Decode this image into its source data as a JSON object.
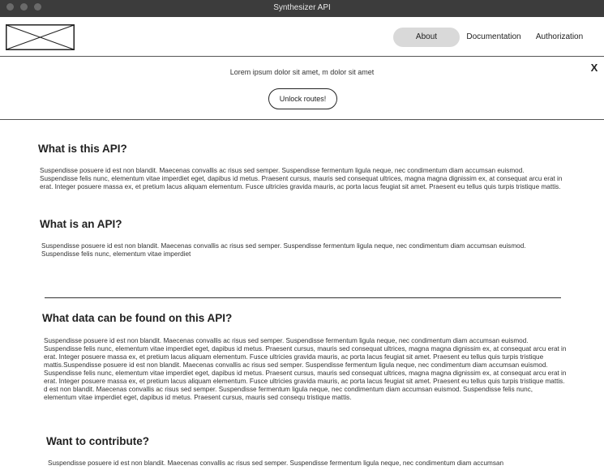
{
  "window": {
    "title": "Synthesizer API"
  },
  "nav": {
    "items": [
      {
        "label": "About",
        "active": true
      },
      {
        "label": "Documentation"
      },
      {
        "label": "Authorization"
      }
    ]
  },
  "banner": {
    "message": "Lorem ipsum dolor sit amet,  m dolor sit amet",
    "button_label": "Unlock routes!",
    "close_label": "X"
  },
  "sections": [
    {
      "heading": "What is this API?",
      "body": "Suspendisse posuere id est non blandit. Maecenas convallis ac risus sed semper. Suspendisse fermentum ligula neque, nec condimentum diam accumsan euismod. Suspendisse felis nunc, elementum vitae imperdiet eget, dapibus id metus. Praesent cursus, mauris sed consequat ultrices, magna magna dignissim ex, at consequat arcu erat in erat. Integer posuere massa ex, et pretium lacus aliquam elementum. Fusce ultricies gravida mauris, ac porta lacus feugiat sit amet. Praesent eu tellus quis turpis tristique mattis."
    },
    {
      "heading": "What is an API?",
      "body": "Suspendisse posuere id est non blandit. Maecenas convallis ac risus sed semper. Suspendisse fermentum ligula neque, nec condimentum diam accumsan euismod. Suspendisse felis nunc, elementum vitae imperdiet"
    },
    {
      "heading": "What data can be found on this API?",
      "body": "Suspendisse posuere id est non blandit. Maecenas convallis ac risus sed semper. Suspendisse fermentum ligula neque, nec condimentum diam accumsan euismod. Suspendisse felis nunc, elementum vitae imperdiet eget, dapibus id metus. Praesent cursus, mauris sed consequat ultrices, magna magna dignissim ex, at consequat arcu erat in erat. Integer posuere massa ex, et pretium lacus aliquam elementum. Fusce ultricies gravida mauris, ac porta lacus feugiat sit amet. Praesent eu tellus quis turpis tristique mattis.Suspendisse posuere id est non blandit. Maecenas convallis ac risus sed semper. Suspendisse fermentum ligula neque, nec condimentum diam accumsan euismod. Suspendisse felis nunc, elementum vitae imperdiet eget, dapibus id metus. Praesent cursus, mauris sed consequat ultrices, magna magna dignissim ex, at consequat arcu erat in erat. Integer posuere massa ex, et pretium lacus aliquam elementum. Fusce ultricies gravida mauris, ac porta lacus feugiat sit amet. Praesent eu tellus quis turpis tristique mattis. d est non blandit. Maecenas convallis ac risus sed semper. Suspendisse fermentum ligula neque, nec condimentum diam accumsan euismod. Suspendisse felis nunc, elementum vitae imperdiet eget, dapibus id metus. Praesent cursus, mauris sed consequ tristique mattis."
    },
    {
      "heading": "Want to contribute?",
      "body": "Suspendisse posuere id est non blandit. Maecenas convallis ac risus sed semper. Suspendisse fermentum ligula neque, nec condimentum diam accumsan"
    }
  ]
}
